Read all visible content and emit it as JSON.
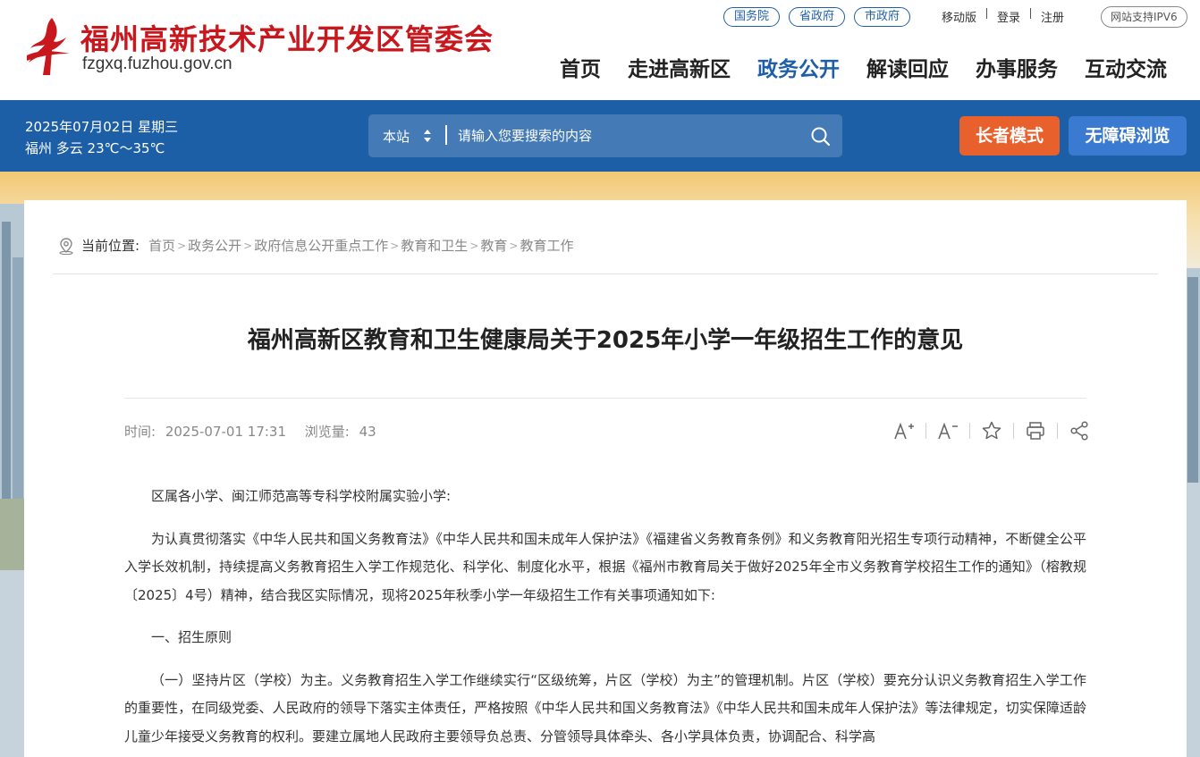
{
  "header": {
    "site_name": "福州高新技术产业开发区管委会",
    "domain": "fzgxq.fuzhou.gov.cn",
    "gov_links": [
      "国务院",
      "省政府",
      "市政府"
    ],
    "top_links": [
      "移动版",
      "登录",
      "注册"
    ],
    "ipv6": "网站支持IPV6",
    "nav": [
      "首页",
      "走进高新区",
      "政务公开",
      "解读回应",
      "办事服务",
      "互动交流"
    ],
    "active_nav": "政务公开",
    "brand_color": "#c9171e",
    "accent_color": "#1f5fa8"
  },
  "bar": {
    "date": "2025年07月02日 星期三",
    "weather": "福州 多云 23℃～35℃",
    "search_scope": "本站",
    "search_placeholder": "请输入您要搜索的内容",
    "elder_mode": "长者模式",
    "accessibility": "无障碍浏览",
    "bar_color": "#1c5fa6",
    "elder_color": "#e8612c"
  },
  "breadcrumb": {
    "label": "当前位置:",
    "items": [
      "首页",
      "政务公开",
      "政府信息公开重点工作",
      "教育和卫生",
      "教育",
      "教育工作"
    ]
  },
  "article": {
    "title": "福州高新区教育和卫生健康局关于2025年小学一年级招生工作的意见",
    "time_label": "时间:",
    "time": "2025-07-01 17:31",
    "views_label": "浏览量:",
    "views": "43",
    "tools": [
      "font-increase-icon",
      "font-decrease-icon",
      "favorite-star-icon",
      "print-icon",
      "share-icon"
    ],
    "paragraphs": [
      "区属各小学、闽江师范高等专科学校附属实验小学:",
      "为认真贯彻落实《中华人民共和国义务教育法》《中华人民共和国未成年人保护法》《福建省义务教育条例》和义务教育阳光招生专项行动精神，不断健全公平入学长效机制，持续提高义务教育招生入学工作规范化、科学化、制度化水平，根据《福州市教育局关于做好2025年全市义务教育学校招生工作的通知》（榕教规〔2025〕4号）精神，结合我区实际情况，现将2025年秋季小学一年级招生工作有关事项通知如下:",
      "一、招生原则",
      "（一）坚持片区（学校）为主。义务教育招生入学工作继续实行“区级统筹，片区（学校）为主”的管理机制。片区（学校）要充分认识义务教育招生入学工作的重要性，在同级党委、人民政府的领导下落实主体责任，严格按照《中华人民共和国义务教育法》《中华人民共和国未成年人保护法》等法律规定，切实保障适龄儿童少年接受义务教育的权利。要建立属地人民政府主要领导负总责、分管领导具体牵头、各小学具体负责，协调配合、科学高"
    ]
  }
}
